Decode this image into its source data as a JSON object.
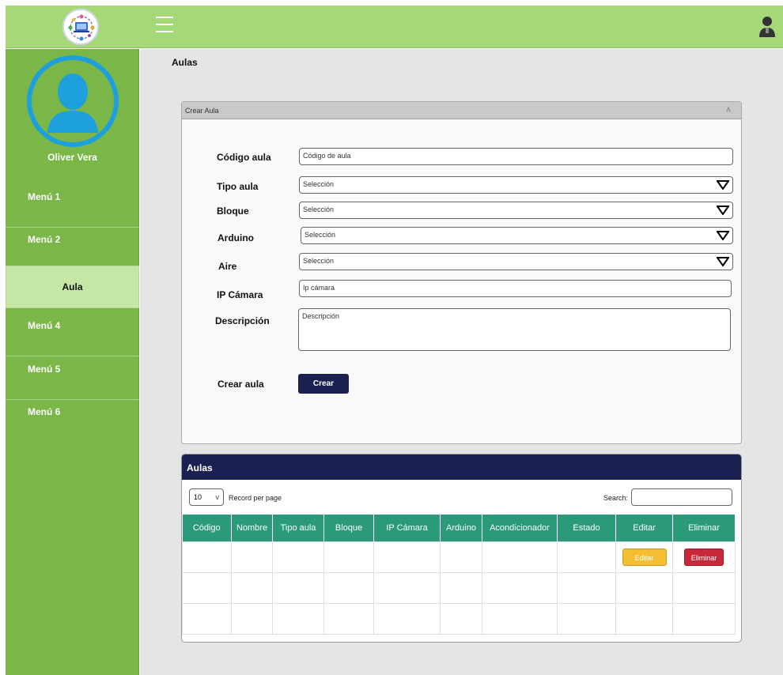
{
  "header": {
    "logo_icon": "network-devices-logo-icon",
    "menu_icon": "hamburger-menu-icon",
    "user_icon": "user-account-icon"
  },
  "sidebar": {
    "user_name": "Oliver Vera",
    "items": [
      {
        "label": "Menú 1"
      },
      {
        "label": "Menú 2"
      },
      {
        "label": "Aula"
      },
      {
        "label": "Menú 4"
      },
      {
        "label": "Menú 5"
      },
      {
        "label": "Menú 6"
      }
    ],
    "active_item": "Aula"
  },
  "page": {
    "title": "Aulas"
  },
  "form": {
    "panel_title": "Crear Aula",
    "fields": {
      "codigo": {
        "label": "Código aula",
        "value": "Código de aula"
      },
      "tipo": {
        "label": "Tipo aula",
        "value": "Selección"
      },
      "bloque": {
        "label": "Bloque",
        "value": "Selección"
      },
      "arduino": {
        "label": "Arduino",
        "value": "Selección"
      },
      "aire": {
        "label": "Aire",
        "value": "Selección"
      },
      "ip": {
        "label": "IP Cámara",
        "value": "Ip cámara"
      },
      "descripcion": {
        "label": "Descripción",
        "value": "Descripción"
      }
    },
    "submit_label_text": "Crear aula",
    "submit_button": "Crear"
  },
  "table_panel": {
    "title": "Aulas",
    "records_per_page": "10",
    "records_per_page_label": "Record per page",
    "search_label": "Search:",
    "columns": [
      "Código",
      "Nombre",
      "Tipo aula",
      "Bloque",
      "IP Cámara",
      "Arduino",
      "Acondicionador",
      "Estado",
      "Editar",
      "Eliminar"
    ],
    "edit_button": "Editar",
    "delete_button": "Eliminar"
  },
  "colors": {
    "header_green": "#a6d878",
    "sidebar_green": "#7ab648",
    "active_item": "#c6e6a6",
    "navy": "#1a2050",
    "table_header": "#2a9a7a",
    "edit": "#f5be32",
    "delete": "#c8283a",
    "avatar_blue": "#1ea0dc"
  }
}
